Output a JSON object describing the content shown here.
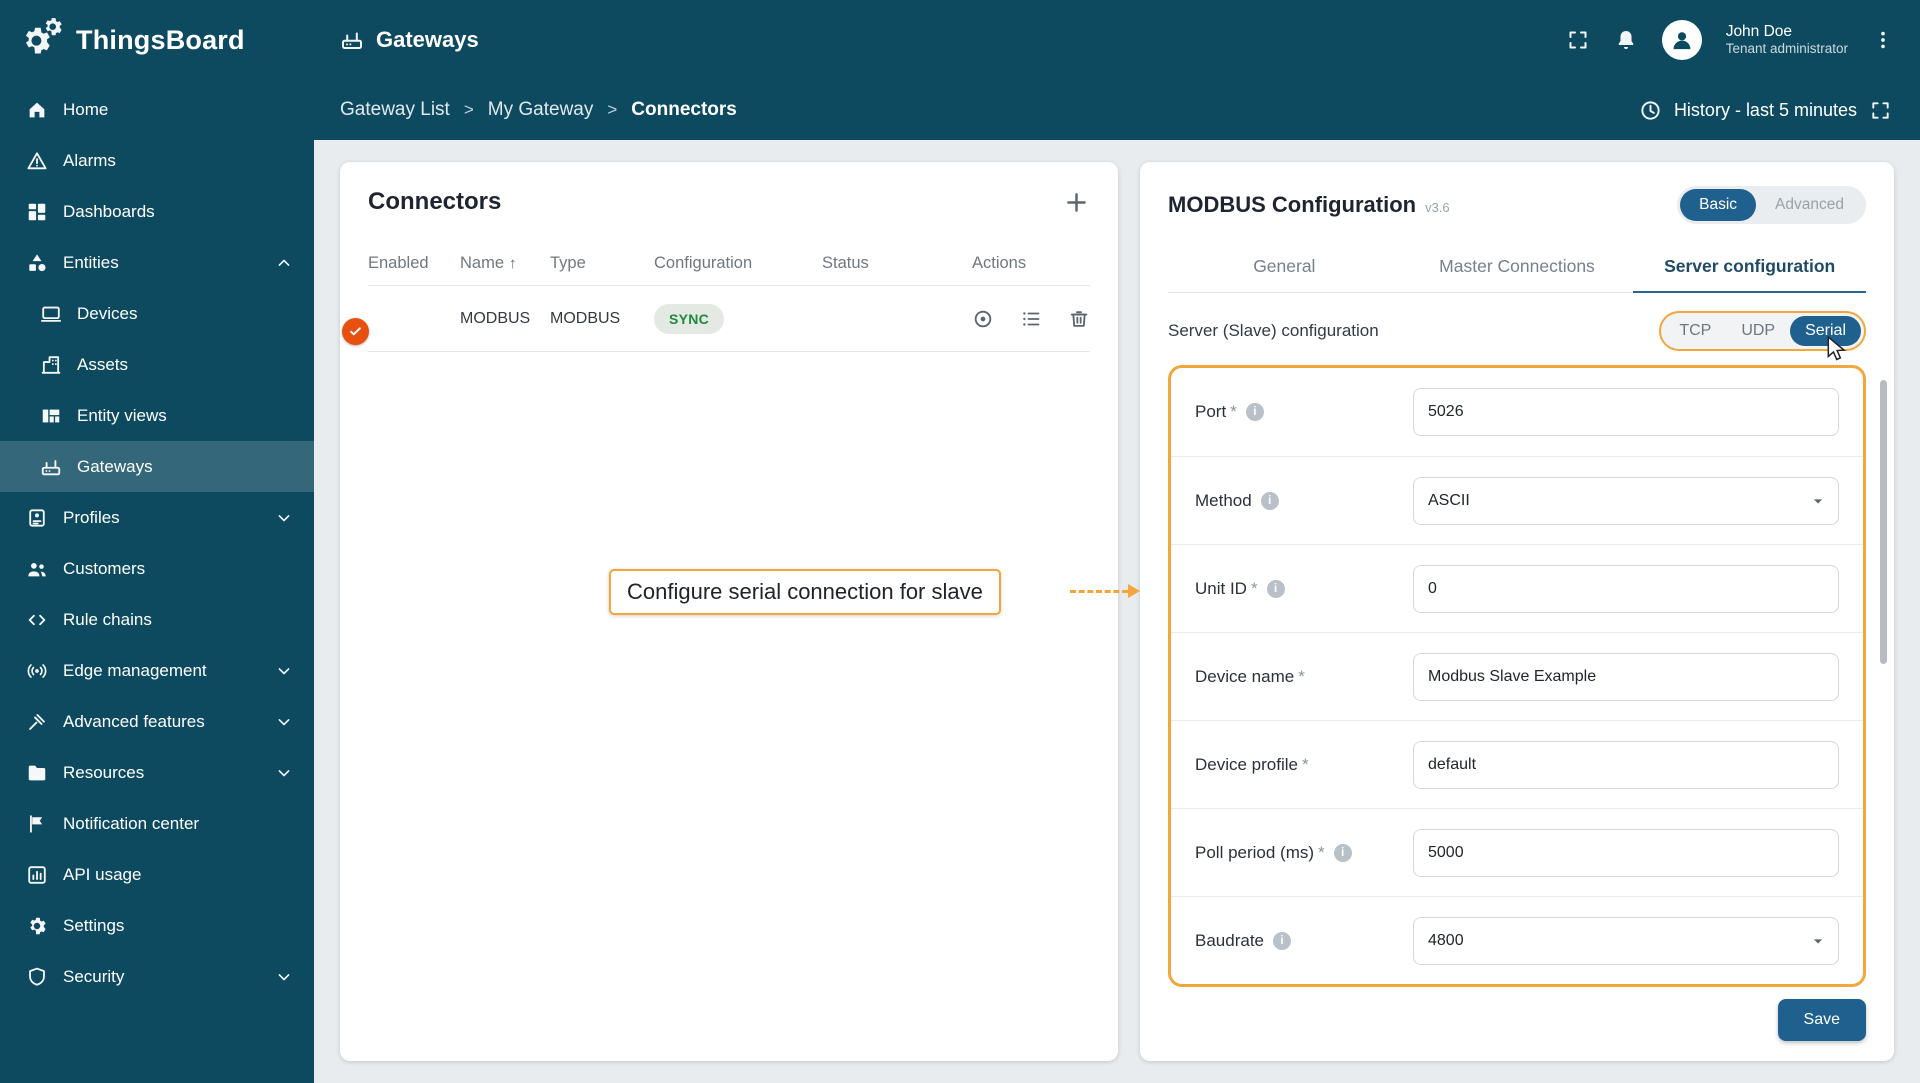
{
  "header": {
    "app_name": "ThingsBoard",
    "page_title": "Gateways",
    "user": {
      "name": "John Doe",
      "role": "Tenant administrator"
    }
  },
  "breadcrumb": {
    "items": [
      "Gateway List",
      "My Gateway",
      "Connectors"
    ],
    "separator": ">",
    "history_label": "History - last 5 minutes"
  },
  "sidebar": {
    "items": [
      {
        "label": "Home"
      },
      {
        "label": "Alarms"
      },
      {
        "label": "Dashboards"
      },
      {
        "label": "Entities"
      },
      {
        "label": "Devices"
      },
      {
        "label": "Assets"
      },
      {
        "label": "Entity views"
      },
      {
        "label": "Gateways"
      },
      {
        "label": "Profiles"
      },
      {
        "label": "Customers"
      },
      {
        "label": "Rule chains"
      },
      {
        "label": "Edge management"
      },
      {
        "label": "Advanced features"
      },
      {
        "label": "Resources"
      },
      {
        "label": "Notification center"
      },
      {
        "label": "API usage"
      },
      {
        "label": "Settings"
      },
      {
        "label": "Security"
      }
    ]
  },
  "connectors": {
    "title": "Connectors",
    "columns": [
      "Enabled",
      "Name",
      "Type",
      "Configuration",
      "Status",
      "Actions"
    ],
    "rows": [
      {
        "name": "MODBUS",
        "type": "MODBUS",
        "configuration": "SYNC",
        "enabled": true,
        "status": "active"
      }
    ]
  },
  "config": {
    "title": "MODBUS Configuration",
    "version": "v3.6",
    "mode": {
      "basic": "Basic",
      "advanced": "Advanced",
      "selected": "Basic"
    },
    "tabs": [
      "General",
      "Master Connections",
      "Server configuration"
    ],
    "active_tab": "Server configuration",
    "section_title": "Server (Slave) configuration",
    "transport": {
      "tcp": "TCP",
      "udp": "UDP",
      "serial": "Serial",
      "selected": "Serial"
    },
    "fields": [
      {
        "label": "Port",
        "value": "5026"
      },
      {
        "label": "Method",
        "value": "ASCII"
      },
      {
        "label": "Unit ID",
        "value": "0"
      },
      {
        "label": "Device name",
        "value": "Modbus Slave Example"
      },
      {
        "label": "Device profile",
        "value": "default"
      },
      {
        "label": "Poll period (ms)",
        "value": "5000"
      },
      {
        "label": "Baudrate",
        "value": "4800"
      }
    ],
    "save_label": "Save"
  },
  "callout": {
    "text": "Configure serial connection for slave"
  },
  "glyphs": {
    "required": "*",
    "info": "i",
    "sort_asc": "↑"
  },
  "colors": {
    "sidebar_bg": "#0d4a60",
    "primary": "#20608f",
    "highlight": "#f2a63b",
    "toggle_orange": "#e8500f",
    "success_green": "#17a73a",
    "sync_chip_text": "#1d8a3c"
  }
}
